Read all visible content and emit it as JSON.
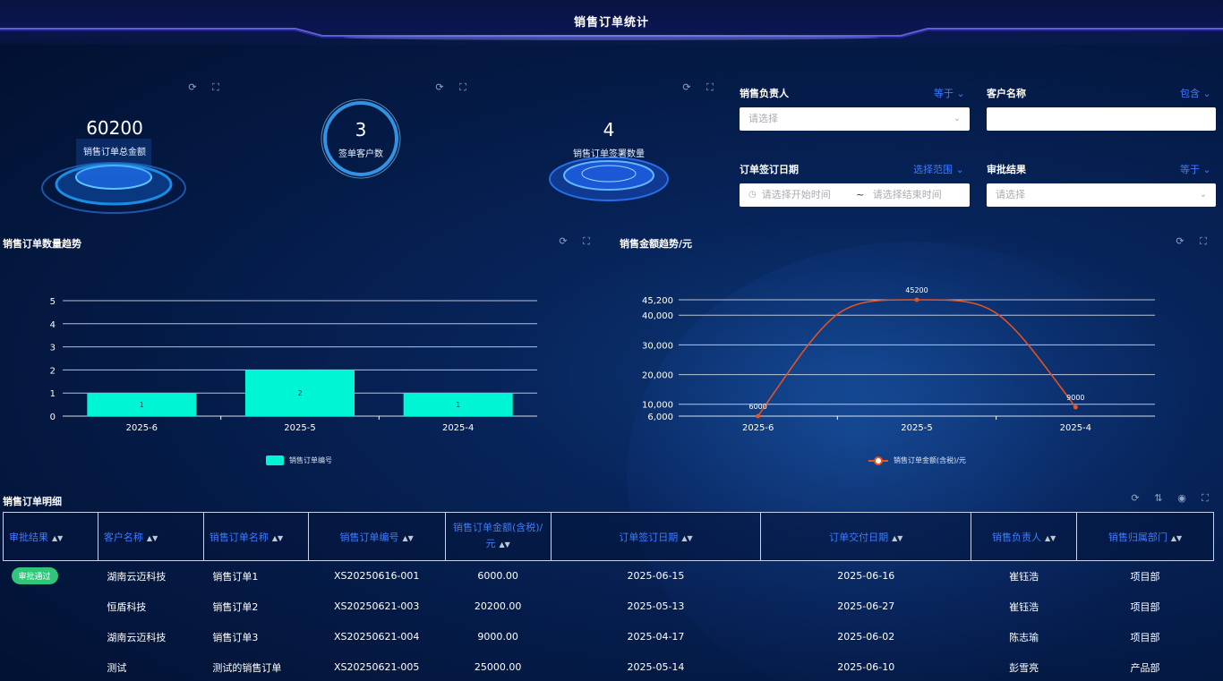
{
  "header": {
    "title": "销售订单统计"
  },
  "kpis": [
    {
      "value": "60200",
      "label": "销售订单总金额"
    },
    {
      "value": "3",
      "label": "签单客户数"
    },
    {
      "value": "4",
      "label": "销售订单签署数量"
    }
  ],
  "filters": {
    "sales_owner": {
      "label": "销售负责人",
      "operator": "等于",
      "placeholder": "请选择"
    },
    "customer_name": {
      "label": "客户名称",
      "operator": "包含",
      "value": ""
    },
    "sign_date": {
      "label": "订单签订日期",
      "operator": "选择范围",
      "start_placeholder": "请选择开始时间",
      "separator": "~",
      "end_placeholder": "请选择结束时间"
    },
    "approval": {
      "label": "审批结果",
      "operator": "等于",
      "placeholder": "请选择"
    }
  },
  "count_chart": {
    "title": "销售订单数量趋势",
    "chart_data": {
      "type": "bar",
      "categories": [
        "2025-6",
        "2025-5",
        "2025-4"
      ],
      "series": [
        {
          "name": "销售订单编号",
          "values": [
            1,
            2,
            1
          ]
        }
      ],
      "ylim": [
        0,
        5
      ],
      "yticks": [
        0,
        1,
        2,
        3,
        4,
        5
      ],
      "color": "#00f5d4",
      "legend": "bottom"
    }
  },
  "amount_chart": {
    "title": "销售金额趋势/元",
    "chart_data": {
      "type": "line",
      "categories": [
        "2025-6",
        "2025-5",
        "2025-4"
      ],
      "series": [
        {
          "name": "销售订单金额(含税)/元",
          "values": [
            6000,
            45200,
            9000
          ]
        }
      ],
      "ylim": [
        6000,
        45200
      ],
      "yticks": [
        6000,
        10000,
        20000,
        30000,
        40000,
        45200
      ],
      "ytick_labels": [
        "6,000",
        "10,000",
        "20,000",
        "30,000",
        "40,000",
        "45,200"
      ],
      "data_labels": [
        "6000",
        "45200",
        "9000"
      ],
      "color": "#e8541e",
      "legend": "bottom"
    }
  },
  "detail": {
    "title": "销售订单明细",
    "columns": [
      "审批结果",
      "客户名称",
      "销售订单名称",
      "销售订单编号",
      "销售订单金额(含税)/元",
      "订单签订日期",
      "订单交付日期",
      "销售负责人",
      "销售归属部门"
    ],
    "rows": [
      {
        "status": "审批通过",
        "customer": "湖南云迈科技",
        "name": "销售订单1",
        "code": "XS20250616-001",
        "amount": "6000.00",
        "sign": "2025-06-15",
        "deliver": "2025-06-16",
        "owner": "崔钰浩",
        "dept": "项目部"
      },
      {
        "status": "",
        "customer": "恒盾科技",
        "name": "销售订单2",
        "code": "XS20250621-003",
        "amount": "20200.00",
        "sign": "2025-05-13",
        "deliver": "2025-06-27",
        "owner": "崔钰浩",
        "dept": "项目部"
      },
      {
        "status": "",
        "customer": "湖南云迈科技",
        "name": "销售订单3",
        "code": "XS20250621-004",
        "amount": "9000.00",
        "sign": "2025-04-17",
        "deliver": "2025-06-02",
        "owner": "陈志瑜",
        "dept": "项目部"
      },
      {
        "status": "",
        "customer": "测试",
        "name": "测试的销售订单",
        "code": "XS20250621-005",
        "amount": "25000.00",
        "sign": "2025-05-14",
        "deliver": "2025-06-10",
        "owner": "彭雪亮",
        "dept": "产品部"
      }
    ]
  },
  "colors": {
    "accent": "#3e7bff",
    "bar": "#00f5d4",
    "line": "#e8541e",
    "badge": "#2fc67a"
  }
}
